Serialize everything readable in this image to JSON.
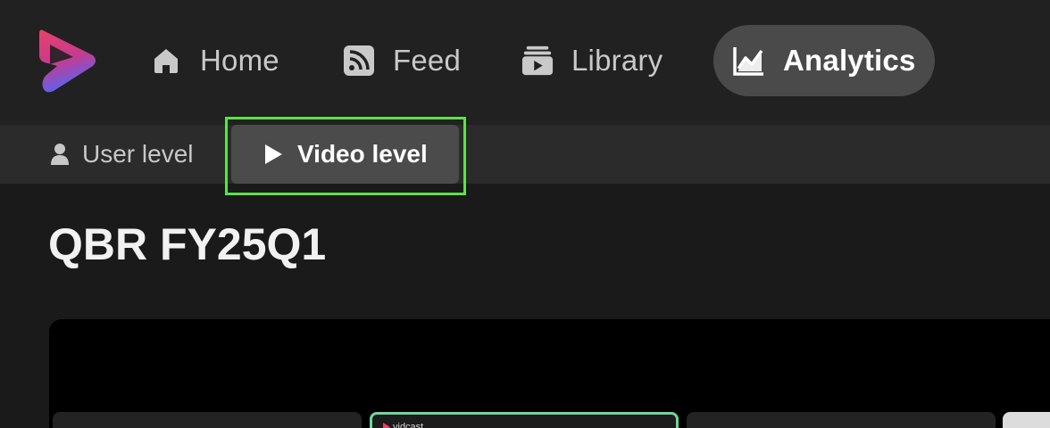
{
  "nav": {
    "items": [
      {
        "label": "Home",
        "icon": "home-icon"
      },
      {
        "label": "Feed",
        "icon": "rss-feed-icon"
      },
      {
        "label": "Library",
        "icon": "library-icon"
      },
      {
        "label": "Analytics",
        "icon": "chart-line-icon",
        "active": true
      }
    ]
  },
  "subnav": {
    "items": [
      {
        "label": "User level",
        "icon": "user-icon"
      },
      {
        "label": "Video level",
        "icon": "play-icon",
        "active": true
      }
    ]
  },
  "page": {
    "title": "QBR FY25Q1"
  },
  "thumbnails": {
    "brand_label": "vidcast"
  },
  "colors": {
    "highlight": "#5fe04a",
    "active_thumb_border": "#6fd69a",
    "logo_gradient_start": "#e8426a",
    "logo_gradient_end": "#6b5cf0"
  }
}
